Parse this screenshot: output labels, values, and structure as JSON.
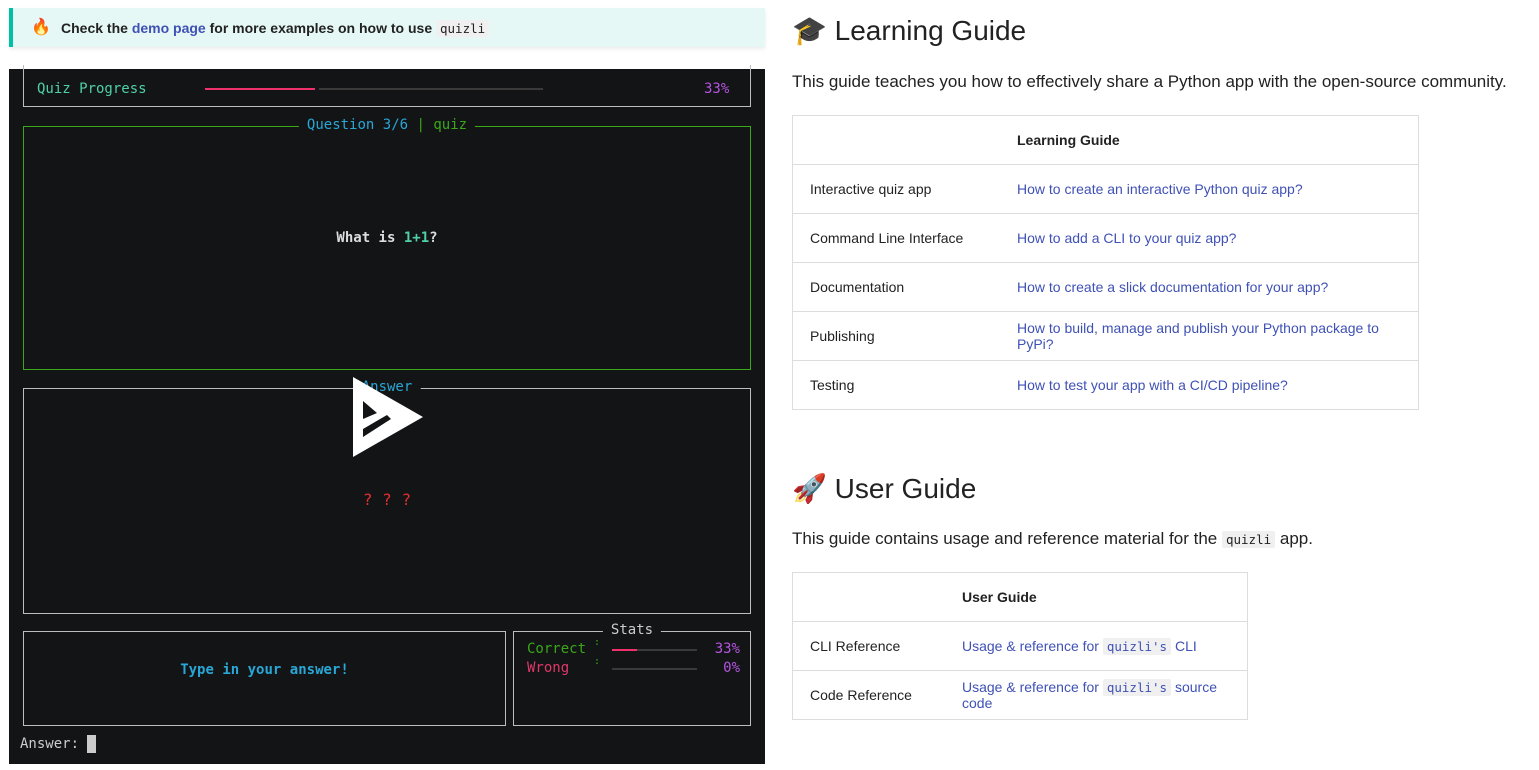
{
  "callout": {
    "pre": "Check the",
    "link": "demo page",
    "mid": "for more examples on how to use",
    "code": "quizli"
  },
  "terminal": {
    "progress_label": "Quiz Progress",
    "progress_value": 33,
    "progress_text": "33%",
    "question_title_a": "Question 3/6",
    "question_title_sep": "|",
    "question_title_b": "quiz",
    "question_pre": "What is ",
    "question_expr": "1+1",
    "question_post": "?",
    "answer_title": "Answer",
    "answer_placeholder": "? ? ?",
    "prompt_hint": "Type in your answer!",
    "stats_title": "Stats",
    "stats": [
      {
        "label": "Correct",
        "value": 33,
        "text": "33%",
        "color": "#3aa818"
      },
      {
        "label": "Wrong",
        "value": 0,
        "text": "0%",
        "color": "#e0386a"
      }
    ],
    "input_label": "Answer:"
  },
  "learning": {
    "title": "Learning Guide",
    "intro": "This guide teaches you how to effectively share a Python app with the open-source community.",
    "header": "Learning Guide",
    "rows": [
      [
        "Interactive quiz app",
        "How to create an interactive Python quiz app?"
      ],
      [
        "Command Line Interface",
        "How to add a CLI to your quiz app?"
      ],
      [
        "Documentation",
        "How to create a slick documentation for your app?"
      ],
      [
        "Publishing",
        "How to build, manage and publish your Python package to PyPi?"
      ],
      [
        "Testing",
        "How to test your app with a CI/CD pipeline?"
      ]
    ]
  },
  "user": {
    "title": "User Guide",
    "intro_pre": "This guide contains usage and reference material for the",
    "intro_code": "quizli",
    "intro_post": "app.",
    "header": "User Guide",
    "rows": [
      {
        "label": "CLI Reference",
        "pre": "Usage & reference for",
        "code": "quizli's",
        "post": "CLI"
      },
      {
        "label": "Code Reference",
        "pre": "Usage & reference for",
        "code": "quizli's",
        "post": "source code"
      }
    ]
  }
}
